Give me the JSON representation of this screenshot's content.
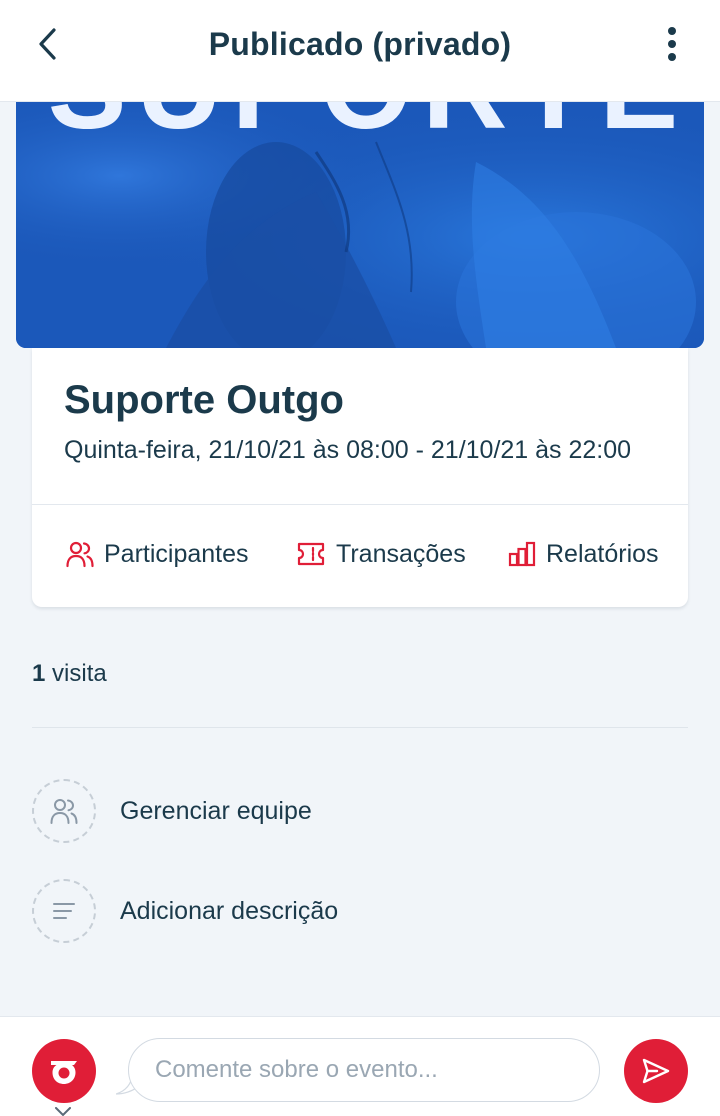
{
  "header": {
    "title": "Publicado (privado)",
    "back_icon": "chevron-left-icon",
    "menu_icon": "more-vertical-icon"
  },
  "banner": {
    "text": "SUPORTE",
    "color": "#1c5fc4"
  },
  "event": {
    "title": "Suporte Outgo",
    "date": "Quinta-feira, 21/10/21 às 08:00 - 21/10/21 às 22:00"
  },
  "actions": [
    {
      "label": "Participantes",
      "icon": "users-icon"
    },
    {
      "label": "Transações",
      "icon": "ticket-icon"
    },
    {
      "label": "Relatórios",
      "icon": "bar-chart-icon"
    }
  ],
  "visits": {
    "count": "1",
    "label": "visita"
  },
  "list": [
    {
      "label": "Gerenciar equipe",
      "icon": "users-icon"
    },
    {
      "label": "Adicionar descrição",
      "icon": "text-align-icon"
    }
  ],
  "footer": {
    "comment_placeholder": "Comente sobre o evento...",
    "avatar_icon": "outgo-logo-icon",
    "send_icon": "send-icon"
  },
  "colors": {
    "accent": "#e01e37",
    "text": "#1b3a4b",
    "background": "#f1f5f9"
  }
}
